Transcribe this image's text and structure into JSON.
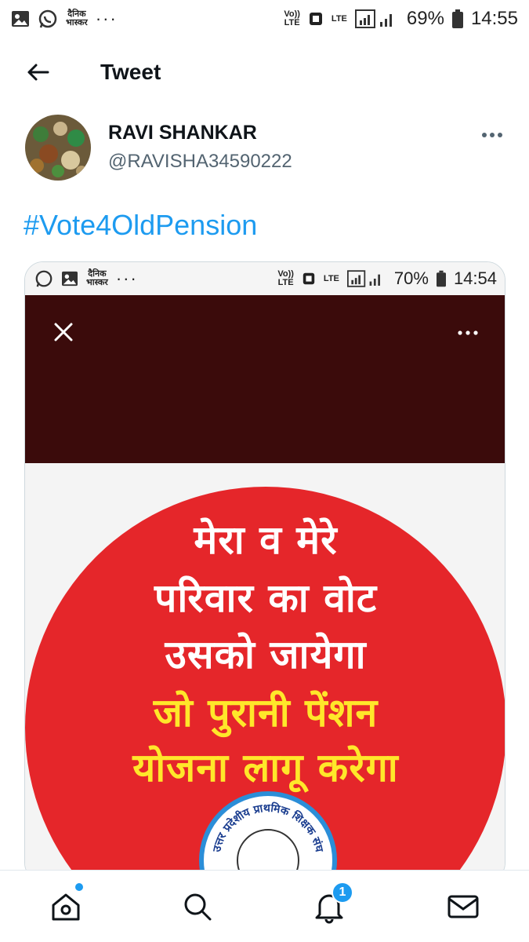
{
  "status_bar": {
    "left_icons": [
      "gallery-icon",
      "whatsapp-icon",
      "dainik-bhaskar-icon"
    ],
    "dainik_top": "दैनिक",
    "dainik_bottom": "भास्कर",
    "volte_top": "Vo))",
    "volte_bottom": "LTE",
    "lte": "LTE",
    "more": "···",
    "battery": "69%",
    "time": "14:55"
  },
  "header": {
    "title": "Tweet",
    "back_icon": "arrow-left-icon"
  },
  "tweet": {
    "author_name": "RAVI SHANKAR",
    "author_handle": "@RAVISHA34590222",
    "hashtag": "#Vote4OldPension",
    "more_icon": "more-dots-icon"
  },
  "media": {
    "inner_status": {
      "dainik_top": "दैनिक",
      "dainik_bottom": "भास्कर",
      "volte_top": "Vo))",
      "volte_bottom": "LTE",
      "lte": "LTE",
      "more": "···",
      "battery": "70%",
      "time": "14:54"
    },
    "poster_lines": [
      "मेरा व मेरे",
      "परिवार का वोट",
      "उसको जायेगा",
      "जो पुरानी पेंशन",
      "योजना लागू करेगा"
    ],
    "seal_text": "उत्तर प्रदेशीय प्राथमिक शिक्षक संघ",
    "colors": {
      "background_band": "#3b0b0b",
      "circle": "#e5262a",
      "white_text": "#ffffff",
      "yellow_text": "#ffe72a"
    }
  },
  "bottom_nav": {
    "items": [
      "home-icon",
      "search-icon",
      "notifications-icon",
      "messages-icon"
    ],
    "notification_count": "1"
  },
  "colors": {
    "accent": "#1d9bf0",
    "secondary_text": "#536471"
  }
}
